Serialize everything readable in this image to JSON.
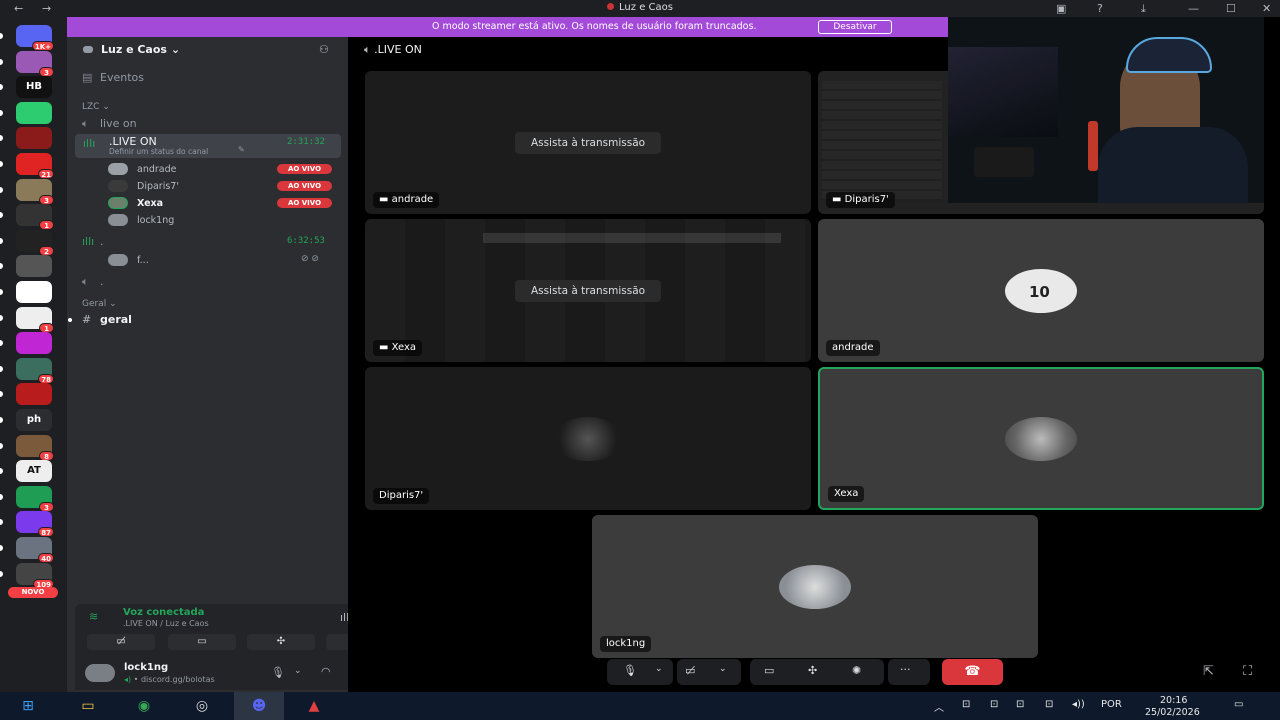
{
  "window": {
    "title": "Luz e Caos"
  },
  "banner": {
    "text": "O modo streamer está ativo. Os nomes de usuário foram truncados.",
    "button": "Desativar"
  },
  "servers": [
    {
      "badge": "1K+",
      "color": "#5865f2"
    },
    {
      "badge": "3",
      "color": "#9b59b6"
    },
    {
      "badge": "",
      "color": "#111111",
      "label": "HB"
    },
    {
      "badge": "",
      "color": "#2ecc71"
    },
    {
      "badge": "",
      "color": "#8b1a1a"
    },
    {
      "badge": "21",
      "color": "#e02424"
    },
    {
      "badge": "3",
      "color": "#8a7a5a"
    },
    {
      "badge": "1",
      "color": "#333333"
    },
    {
      "badge": "2",
      "color": "#222222"
    },
    {
      "badge": "",
      "color": "#555555"
    },
    {
      "badge": "",
      "color": "#ffffff"
    },
    {
      "badge": "1",
      "color": "#eeeeee"
    },
    {
      "badge": "",
      "color": "#c026d3"
    },
    {
      "badge": "78",
      "color": "#3b6e5e"
    },
    {
      "badge": "",
      "color": "#b91c1c"
    },
    {
      "badge": "",
      "color": "#2b2d31",
      "label": "ph"
    },
    {
      "badge": "8",
      "color": "#7a5a3a"
    },
    {
      "badge": "",
      "color": "#eeeeee",
      "label": "AT"
    },
    {
      "badge": "3",
      "color": "#1f9d55"
    },
    {
      "badge": "87",
      "color": "#7c3aed"
    },
    {
      "badge": "40",
      "color": "#6b7280"
    },
    {
      "badge": "109",
      "color": "#444444"
    }
  ],
  "novo": "NOVO",
  "sidebar": {
    "server_name": "Luz e Caos",
    "events": "Eventos",
    "cat_lzc": "LZC",
    "chan_live_on": "live on",
    "chan_LIVE": ".LIVE ON",
    "chan_status": "Definir um status do canal",
    "timer1": "2:31:32",
    "users": [
      {
        "name": "andrade",
        "live": "AO VIVO"
      },
      {
        "name": "Diparis7'",
        "live": "AO VIVO"
      },
      {
        "name": "Xexa",
        "live": "AO VIVO"
      },
      {
        "name": "lock1ng",
        "live": ""
      }
    ],
    "chan_dot": ".",
    "timer2": "6:32:53",
    "user2": "f...",
    "chan_dot2": ".",
    "cat_geral": "Geral",
    "chan_geral": "geral"
  },
  "voice": {
    "status": "Voz conectada",
    "channel": ".LIVE ON / Luz e Caos"
  },
  "user": {
    "name": "lock1ng",
    "status": "discord.gg/bolotas"
  },
  "stage": {
    "title": ".LIVE ON",
    "watch": "Assista à transmissão",
    "tiles": {
      "t1": "andrade",
      "t2": "Diparis7'",
      "t3": "Xexa",
      "t4": "andrade",
      "t5": "Diparis7'",
      "t6": "Xexa",
      "t7": "lock1ng"
    },
    "jersey": "10"
  },
  "taskbar": {
    "lang": "POR",
    "time": "20:16",
    "date": "25/02/2026"
  }
}
